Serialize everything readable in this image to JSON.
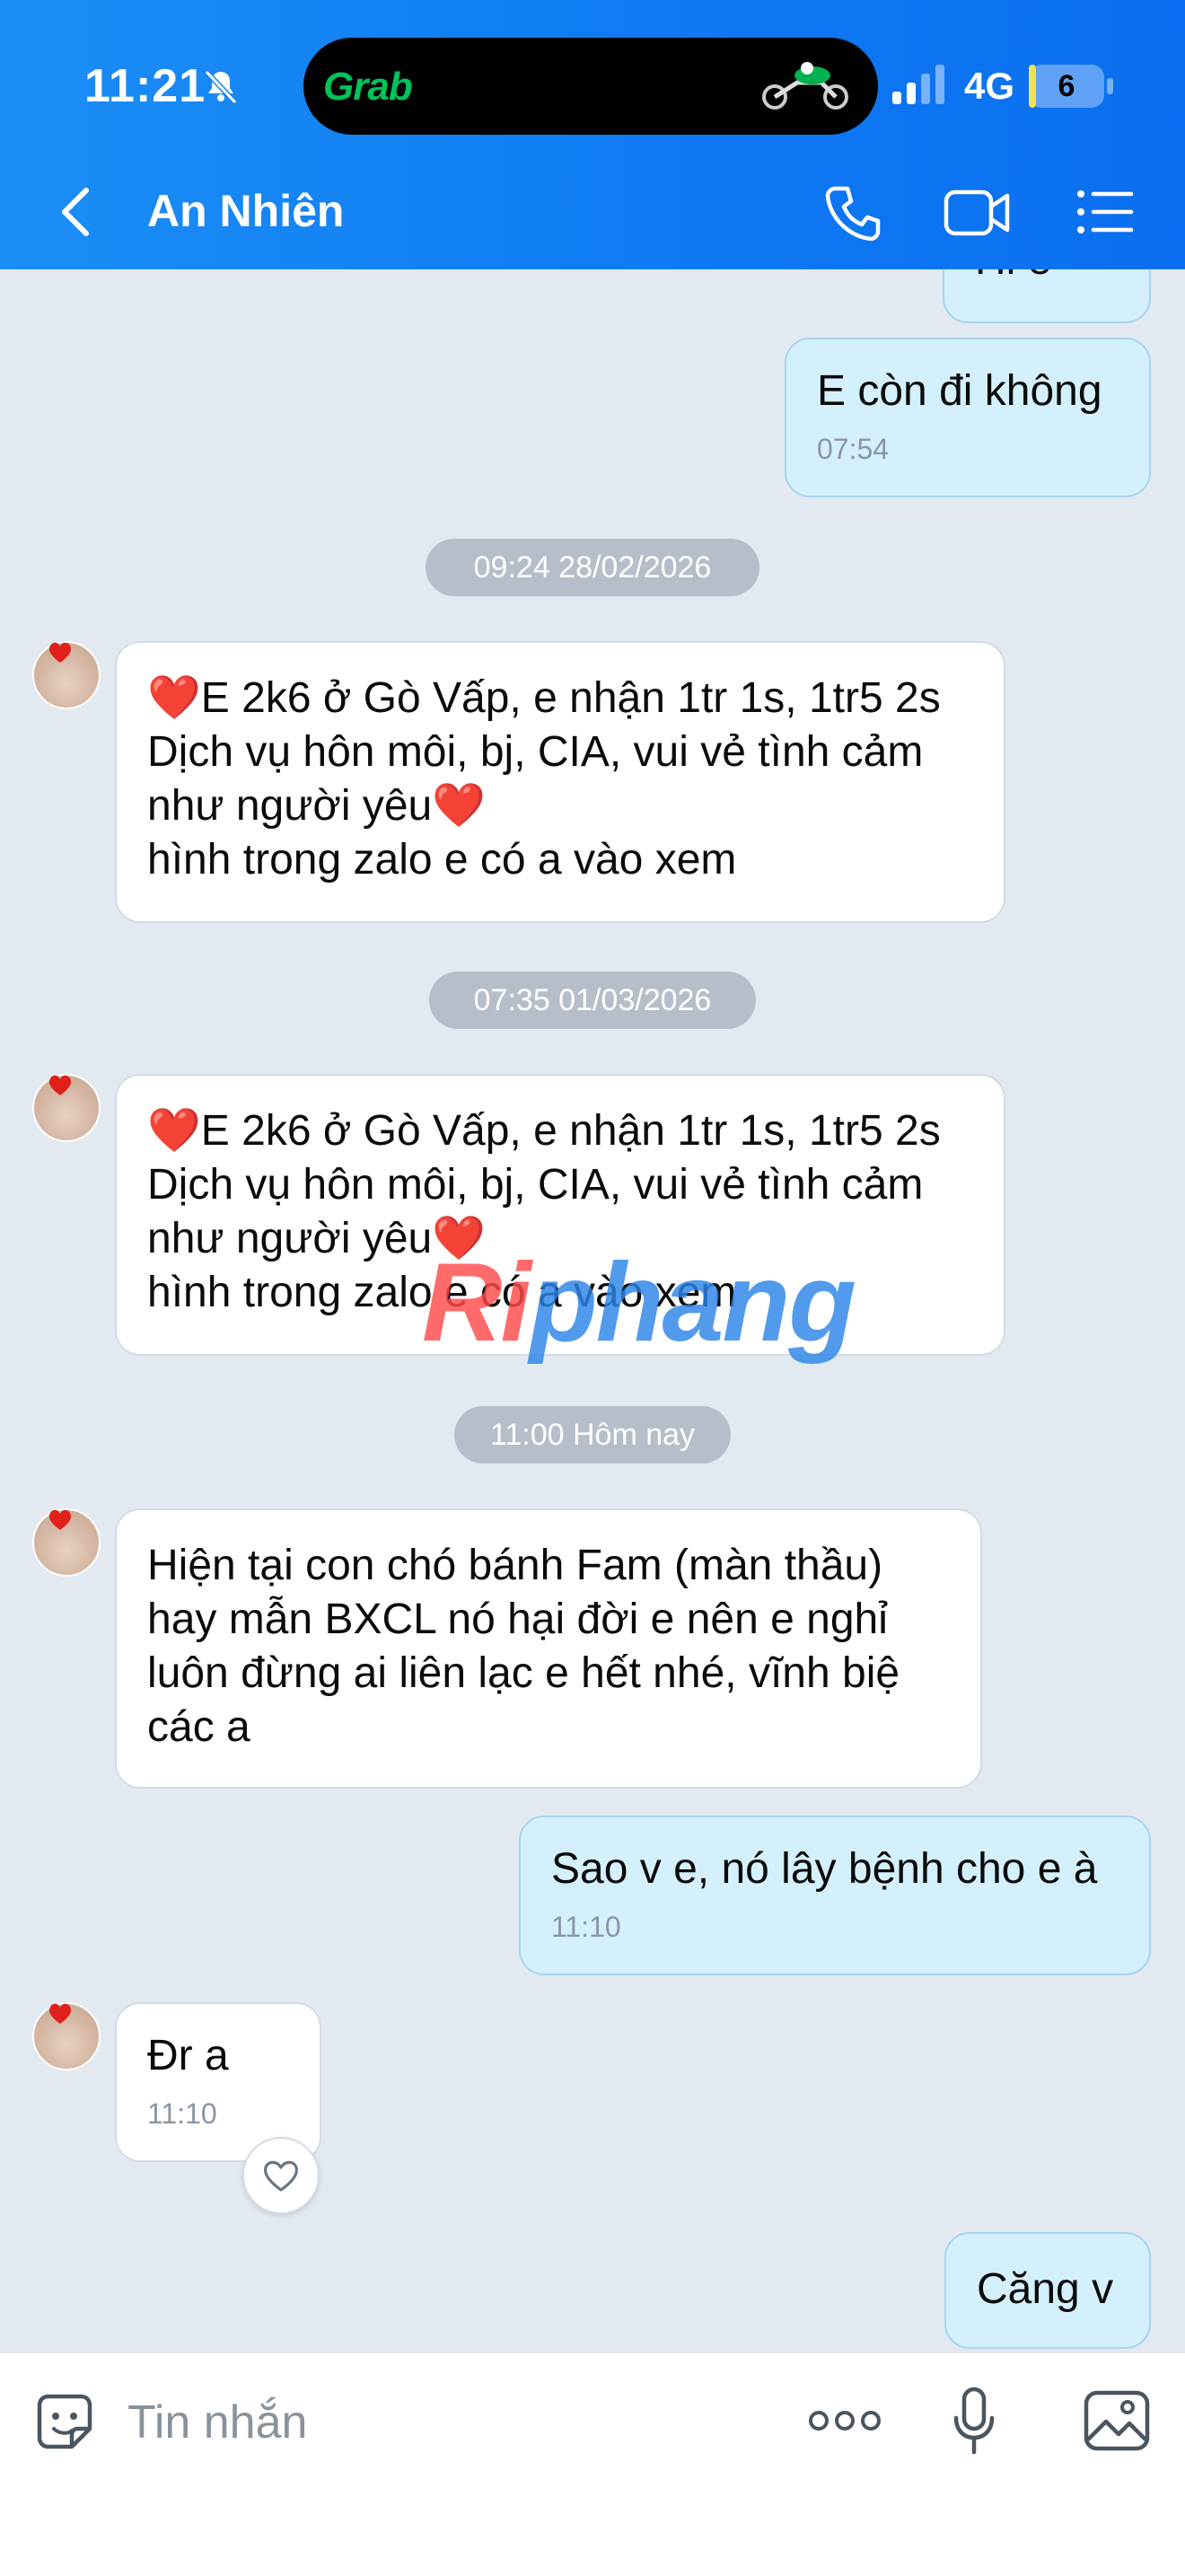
{
  "status_bar": {
    "time": "11:21",
    "island_app": "Grab",
    "network": "4G",
    "battery_level": "6",
    "battery_fraction": 0.06,
    "accent_green": "#00c35a"
  },
  "header": {
    "contact_name": "An Nhiên",
    "background_color": "#0f7af3",
    "icons": [
      "back-icon",
      "call-icon",
      "video-call-icon",
      "menu-icon"
    ]
  },
  "messages": [
    {
      "direction": "out",
      "text": "Hi e",
      "time": ""
    },
    {
      "direction": "out",
      "text": "E còn đi không",
      "time": "07:54"
    },
    {
      "type": "date",
      "text": "09:24 28/02/2026"
    },
    {
      "direction": "in",
      "lines": [
        "❤️E 2k6 ở Gò Vấp, e nhận 1tr 1s, 1tr5 2s",
        "Dịch vụ hôn môi, bj, CIA, vui vẻ tình cảm",
        "như người yêu❤️",
        "hình trong zalo e có a vào xem"
      ]
    },
    {
      "type": "date",
      "text": "07:35 01/03/2026"
    },
    {
      "direction": "in",
      "lines": [
        "❤️E 2k6 ở Gò Vấp, e nhận 1tr 1s, 1tr5 2s",
        "Dịch vụ hôn môi, bj, CIA, vui vẻ tình cảm",
        "như người yêu❤️",
        "hình trong zalo e có a vào xem"
      ]
    },
    {
      "type": "date",
      "text": "11:00 Hôm nay"
    },
    {
      "direction": "in",
      "lines": [
        "Hiện tại con chó bánh Fam (màn thầu)",
        "hay mẫn BXCL nó hại đời e nên e nghỉ",
        "luôn đừng ai liên lạc e hết nhé, vĩnh biệ",
        "các a"
      ]
    },
    {
      "direction": "out",
      "text": "Sao v e, nó lây bệnh cho e à",
      "time": "11:10"
    },
    {
      "direction": "in",
      "text": "Đr a",
      "time": "11:10"
    },
    {
      "direction": "out",
      "text": "Căng v"
    }
  ],
  "watermark": {
    "part1": "Ri",
    "part2": "phang"
  },
  "composer": {
    "placeholder": "Tin nhắn",
    "icons": [
      "sticker-icon",
      "more-icon",
      "microphone-icon",
      "image-icon"
    ]
  },
  "colors": {
    "chat_background": "#e2e9f1",
    "outgoing_bubble": "#d4f0fd",
    "incoming_bubble": "#ffffff",
    "date_chip": "#b6bfc9"
  }
}
